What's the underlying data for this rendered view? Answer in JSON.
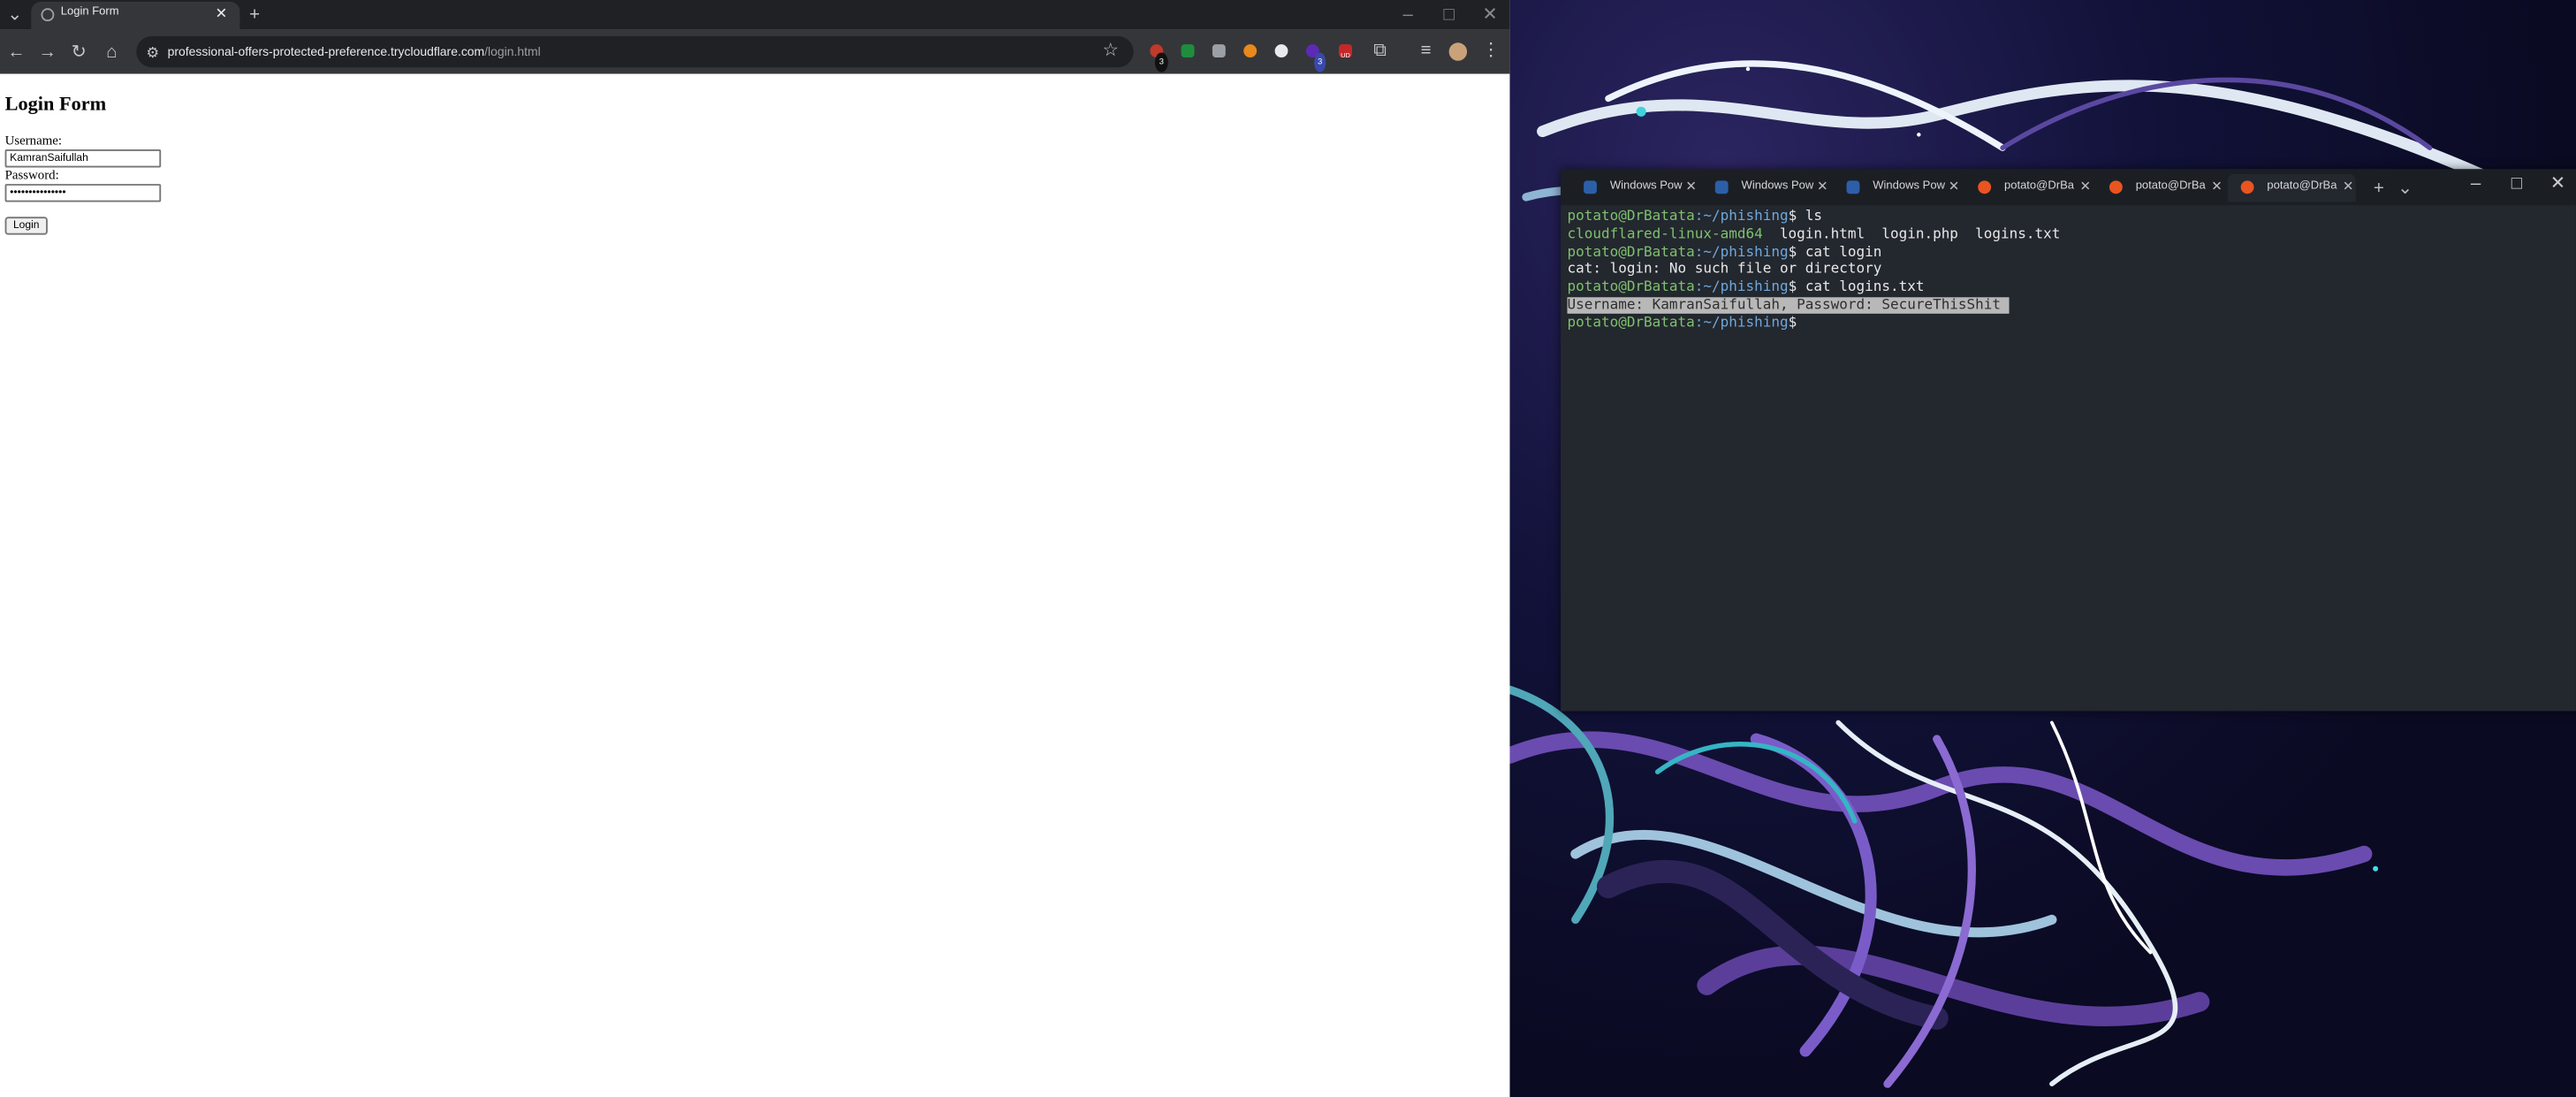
{
  "browser": {
    "tab_title": "Login Form",
    "url_host": "professional-offers-protected-preference.trycloudflare.com",
    "url_path": "/login.html",
    "extension_badge_1": "3",
    "extension_badge_2": "3",
    "extension_badge_3": "UD"
  },
  "page": {
    "heading": "Login Form",
    "username_label": "Username:",
    "username_value": "KamranSaifullah",
    "password_label": "Password:",
    "password_value": "•••••••••••••••",
    "login_button": "Login"
  },
  "terminal": {
    "tabs": [
      {
        "label": "Windows Pow",
        "kind": "powershell"
      },
      {
        "label": "Windows Pow",
        "kind": "powershell"
      },
      {
        "label": "Windows Pow",
        "kind": "powershell"
      },
      {
        "label": "potato@DrBa",
        "kind": "ubuntu"
      },
      {
        "label": "potato@DrBa",
        "kind": "ubuntu"
      },
      {
        "label": "potato@DrBa",
        "kind": "ubuntu"
      }
    ],
    "lines": [
      {
        "prompt_user": "potato@DrBatata",
        "prompt_path": ":~/phishing",
        "cmd": "$ ls"
      },
      {
        "output": "cloudflared-linux-amd64",
        "output_rest": "  login.html  login.php  logins.txt"
      },
      {
        "prompt_user": "potato@DrBatata",
        "prompt_path": ":~/phishing",
        "cmd": "$ cat login"
      },
      {
        "output_plain": "cat: login: No such file or directory"
      },
      {
        "prompt_user": "potato@DrBatata",
        "prompt_path": ":~/phishing",
        "cmd": "$ cat logins.txt"
      },
      {
        "selected": "Username: KamranSaifullah, Password: SecureThisShit "
      },
      {
        "prompt_user": "potato@DrBatata",
        "prompt_path": ":~/phishing",
        "cmd": "$"
      }
    ]
  },
  "colors": {
    "prompt_green": "#7ec16e",
    "prompt_blue": "#6fa8dc",
    "terminal_bg": "#23272e",
    "browser_chrome": "#202124"
  }
}
